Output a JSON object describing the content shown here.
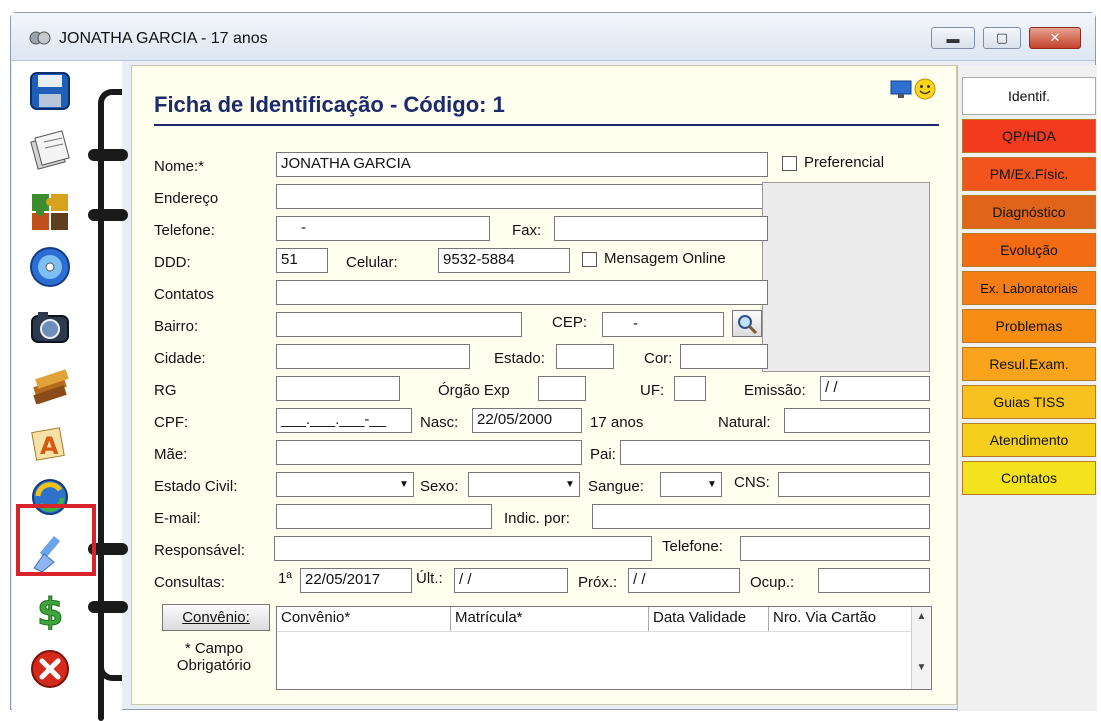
{
  "window": {
    "title": "JONATHA GARCIA - 17 anos",
    "minimize_glyph": "▬",
    "maximize_glyph": "▢",
    "close_glyph": "✕"
  },
  "toolbar": {
    "icons": [
      "save-icon",
      "documents-icon",
      "puzzle-icon",
      "cd-icon",
      "camera-icon",
      "books-icon",
      "font-icon",
      "sync-icon",
      "brush-icon",
      "dollar-icon",
      "exit-icon"
    ]
  },
  "form": {
    "heading": "Ficha de Identificação - Código: 1",
    "status_icons": [
      "monitor-icon",
      "smiley-icon"
    ],
    "labels": {
      "nome": "Nome:*",
      "endereco": "Endereço",
      "telefone": "Telefone:",
      "fax": "Fax:",
      "ddd": "DDD:",
      "celular": "Celular:",
      "contatos": "Contatos",
      "bairro": "Bairro:",
      "cep": "CEP:",
      "cidade": "Cidade:",
      "estado": "Estado:",
      "cor": "Cor:",
      "rg": "RG",
      "orgao": "Órgão Exp",
      "uf": "UF:",
      "emissao": "Emissão:",
      "cpf": "CPF:",
      "nasc": "Nasc:",
      "natural": "Natural:",
      "mae": "Mãe:",
      "pai": "Pai:",
      "estado_civil": "Estado Civil:",
      "sexo": "Sexo:",
      "sangue": "Sangue:",
      "cns": "CNS:",
      "email": "E-mail:",
      "indic": "Indic. por:",
      "responsavel": "Responsável:",
      "telefone2": "Telefone:",
      "consultas": "Consultas:",
      "primeira": "1ª",
      "ultima": "Últ.:",
      "proxima": "Próx.:",
      "ocup": "Ocup.:",
      "preferencial": "Preferencial",
      "mensagem": "Mensagem Online",
      "campo_obrigatorio": "* Campo Obrigatório"
    },
    "values": {
      "nome": "JONATHA GARCIA",
      "telefone": "-",
      "ddd": "51",
      "celular": "9532-5884",
      "cep": "-",
      "emissao": "/ /",
      "cpf": "___.___.___-__",
      "nasc": "22/05/2000",
      "idade": "17 anos",
      "consulta_primeira": "22/05/2017",
      "consulta_ultima": "/ /",
      "consulta_proxima": "/ /"
    },
    "convenio_button": "Convênio:",
    "grid_headers": [
      "Convênio*",
      "Matrícula*",
      "Data Validade",
      "Nro. Via Cartão"
    ]
  },
  "tabs": [
    {
      "label": "Identif.",
      "color": "#ffffff"
    },
    {
      "label": "QP/HDA",
      "color": "#f23a1f"
    },
    {
      "label": "PM/Ex.Físic.",
      "color": "#f2541c"
    },
    {
      "label": "Diagnóstico",
      "color": "#e0641a"
    },
    {
      "label": "Evolução",
      "color": "#f36b12"
    },
    {
      "label": "Ex. Laboratoriais",
      "color": "#f57d14"
    },
    {
      "label": "Problemas",
      "color": "#f88d14"
    },
    {
      "label": "Resul.Exam.",
      "color": "#f9a41a"
    },
    {
      "label": "Guias TISS",
      "color": "#f7c21f"
    },
    {
      "label": "Atendimento",
      "color": "#f6cf1c"
    },
    {
      "label": "Contatos",
      "color": "#f3e31c"
    }
  ]
}
